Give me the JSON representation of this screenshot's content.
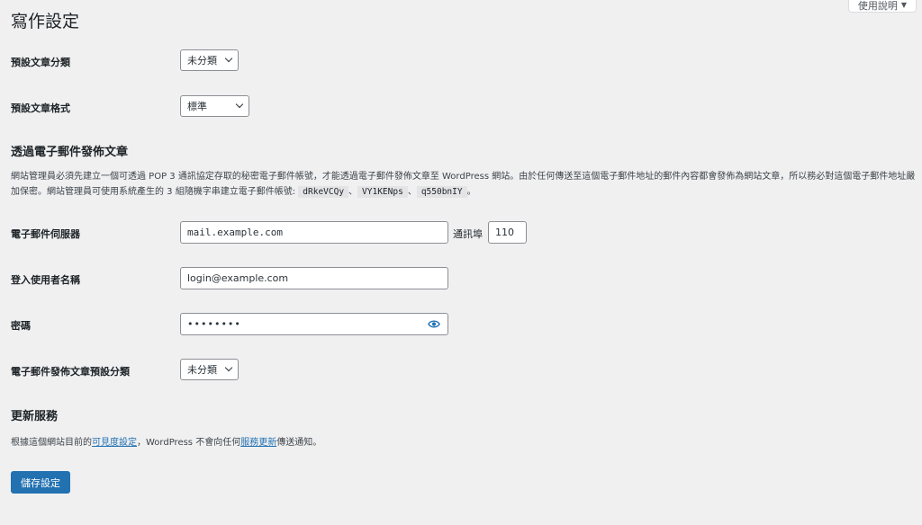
{
  "help_tab": {
    "label": "使用說明",
    "caret": "▼"
  },
  "page_title": "寫作設定",
  "default_category": {
    "label": "預設文章分類",
    "value": "未分類"
  },
  "default_format": {
    "label": "預設文章格式",
    "value": "標準"
  },
  "post_via_email": {
    "heading": "透過電子郵件發佈文章",
    "desc_part1": "網站管理員必須先建立一個可透過 POP 3 通訊協定存取的秘密電子郵件帳號，才能透過電子郵件發佈文章至 WordPress 網站。由於任何傳送至這個電子郵件地址的郵件內容都會發佈為網站文章，所以務必對這個電子郵件地址嚴加保密。網站管理員可使用系統產生的 3 組隨機字串建立電子郵件帳號: ",
    "keys": [
      "dRkeVCQy",
      "VY1KENps",
      "q550bnIY"
    ],
    "key_sep": "、",
    "desc_end": "。"
  },
  "mail_server": {
    "label": "電子郵件伺服器",
    "value": "mail.example.com",
    "port_label": "通訊埠",
    "port_value": "110"
  },
  "login_name": {
    "label": "登入使用者名稱",
    "value": "login@example.com"
  },
  "password": {
    "label": "密碼",
    "value": "••••••••",
    "icon": "eye-icon"
  },
  "email_category": {
    "label": "電子郵件發佈文章預設分類",
    "value": "未分類"
  },
  "update_services": {
    "heading": "更新服務",
    "text_before": "根據這個網站目前的",
    "link1": "可見度設定",
    "text_middle": "，WordPress 不會向任何",
    "link2": "服務更新",
    "text_after": "傳送通知。"
  },
  "save_button": "儲存設定",
  "colors": {
    "accent": "#2271b1",
    "background": "#f0f0f1"
  }
}
